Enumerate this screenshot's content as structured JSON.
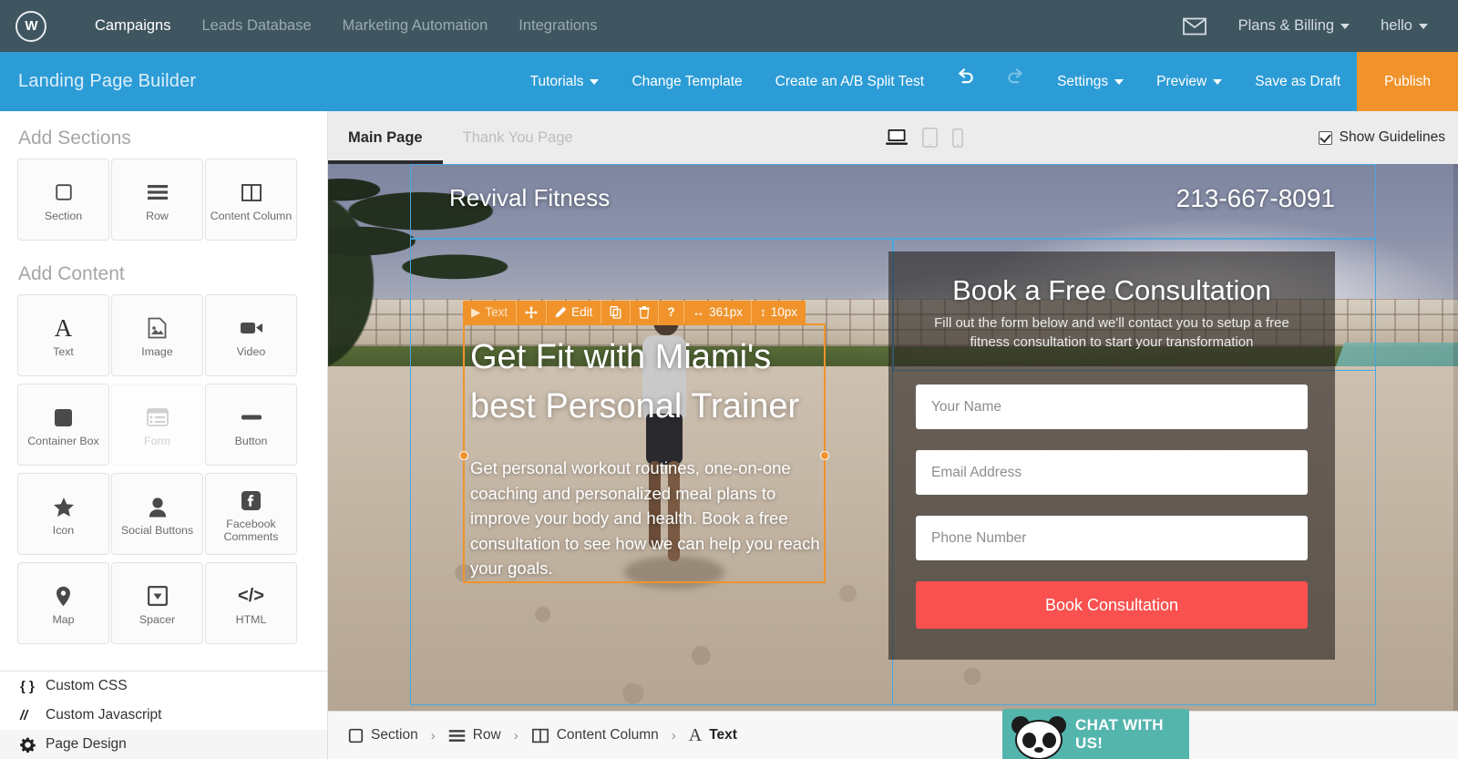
{
  "top_nav": {
    "logo": "W",
    "links": [
      {
        "label": "Campaigns",
        "active": true
      },
      {
        "label": "Leads Database",
        "active": false
      },
      {
        "label": "Marketing Automation",
        "active": false
      },
      {
        "label": "Integrations",
        "active": false
      }
    ],
    "mail_icon": "envelope-icon",
    "plans_billing": "Plans & Billing",
    "account": "hello",
    "background": "#3f5560"
  },
  "builder_bar": {
    "title": "Landing Page Builder",
    "tutorials": "Tutorials",
    "change_template": "Change Template",
    "ab_split_test": "Create an A/B Split Test",
    "undo_icon": "undo-icon",
    "redo_icon": "redo-icon",
    "settings": "Settings",
    "preview": "Preview",
    "save_draft": "Save as Draft",
    "publish": "Publish",
    "background": "#2c9cd6",
    "publish_color": "#f0932b"
  },
  "sidebar": {
    "add_sections_heading": "Add Sections",
    "sections": [
      {
        "label": "Section",
        "icon": "square-outline-icon",
        "disabled": false
      },
      {
        "label": "Row",
        "icon": "rows-icon",
        "disabled": false
      },
      {
        "label": "Content Column",
        "icon": "columns-icon",
        "disabled": false
      }
    ],
    "add_content_heading": "Add Content",
    "content": [
      {
        "label": "Text",
        "icon": "text-a-icon",
        "disabled": false
      },
      {
        "label": "Image",
        "icon": "image-icon",
        "disabled": false
      },
      {
        "label": "Video",
        "icon": "video-camera-icon",
        "disabled": false
      },
      {
        "label": "Container Box",
        "icon": "filled-square-icon",
        "disabled": false
      },
      {
        "label": "Form",
        "icon": "form-list-icon",
        "disabled": true
      },
      {
        "label": "Button",
        "icon": "button-dash-icon",
        "disabled": false
      },
      {
        "label": "Icon",
        "icon": "star-icon",
        "disabled": false
      },
      {
        "label": "Social Buttons",
        "icon": "person-icon",
        "disabled": false
      },
      {
        "label": "Facebook Comments",
        "icon": "facebook-icon",
        "disabled": false
      },
      {
        "label": "Map",
        "icon": "map-pin-icon",
        "disabled": false
      },
      {
        "label": "Spacer",
        "icon": "spacer-icon",
        "disabled": false
      },
      {
        "label": "HTML",
        "icon": "code-icon",
        "disabled": false
      }
    ],
    "bottom_menu": [
      {
        "label": "Custom CSS",
        "icon": "braces-icon"
      },
      {
        "label": "Custom Javascript",
        "icon": "slashes-icon"
      },
      {
        "label": "Page Design",
        "icon": "gear-icon"
      }
    ]
  },
  "canvas_header": {
    "tabs": [
      {
        "label": "Main Page",
        "active": true
      },
      {
        "label": "Thank You Page",
        "active": false
      }
    ],
    "devices": [
      {
        "name": "desktop-icon",
        "active": true
      },
      {
        "name": "tablet-icon",
        "active": false
      },
      {
        "name": "mobile-icon",
        "active": false
      }
    ],
    "show_guidelines_label": "Show Guidelines",
    "show_guidelines_checked": true
  },
  "element_toolbar": {
    "type_label": "Text",
    "play_icon": "play-triangle-icon",
    "move_icon": "move-arrows-icon",
    "edit_label": "Edit",
    "edit_icon": "pencil-icon",
    "duplicate_icon": "copy-icon",
    "delete_icon": "trash-icon",
    "help_icon": "question-mark-icon",
    "width_icon": "arrows-horizontal-icon",
    "width_value": "361px",
    "height_icon": "arrows-vertical-icon",
    "height_value": "10px",
    "color": "#f0932b"
  },
  "landing_page": {
    "brand": "Revival Fitness",
    "phone": "213-667-8091",
    "hero_heading": "Get Fit with Miami's best Personal Trainer",
    "hero_paragraph": "Get personal workout routines, one-on-one coaching and personalized meal plans to improve your body and health. Book a free consultation to see how we can help you reach your goals.",
    "form": {
      "title": "Book a Free Consultation",
      "subtitle": "Fill out the form below and we'll contact you to setup a free fitness consultation to start your transformation",
      "fields": [
        {
          "placeholder": "Your Name",
          "value": ""
        },
        {
          "placeholder": "Email Address",
          "value": ""
        },
        {
          "placeholder": "Phone Number",
          "value": ""
        }
      ],
      "submit_label": "Book Consultation",
      "submit_color": "#f9514f"
    }
  },
  "breadcrumb": {
    "items": [
      {
        "label": "Section",
        "icon": "square-outline-icon",
        "current": false
      },
      {
        "label": "Row",
        "icon": "rows-icon",
        "current": false
      },
      {
        "label": "Content Column",
        "icon": "columns-icon",
        "current": false
      },
      {
        "label": "Text",
        "icon": "text-a-icon",
        "current": true
      }
    ],
    "separator": "›"
  },
  "chat_widget": {
    "label": "CHAT WITH US!",
    "icon": "panda-icon",
    "color": "#54b5ad"
  }
}
